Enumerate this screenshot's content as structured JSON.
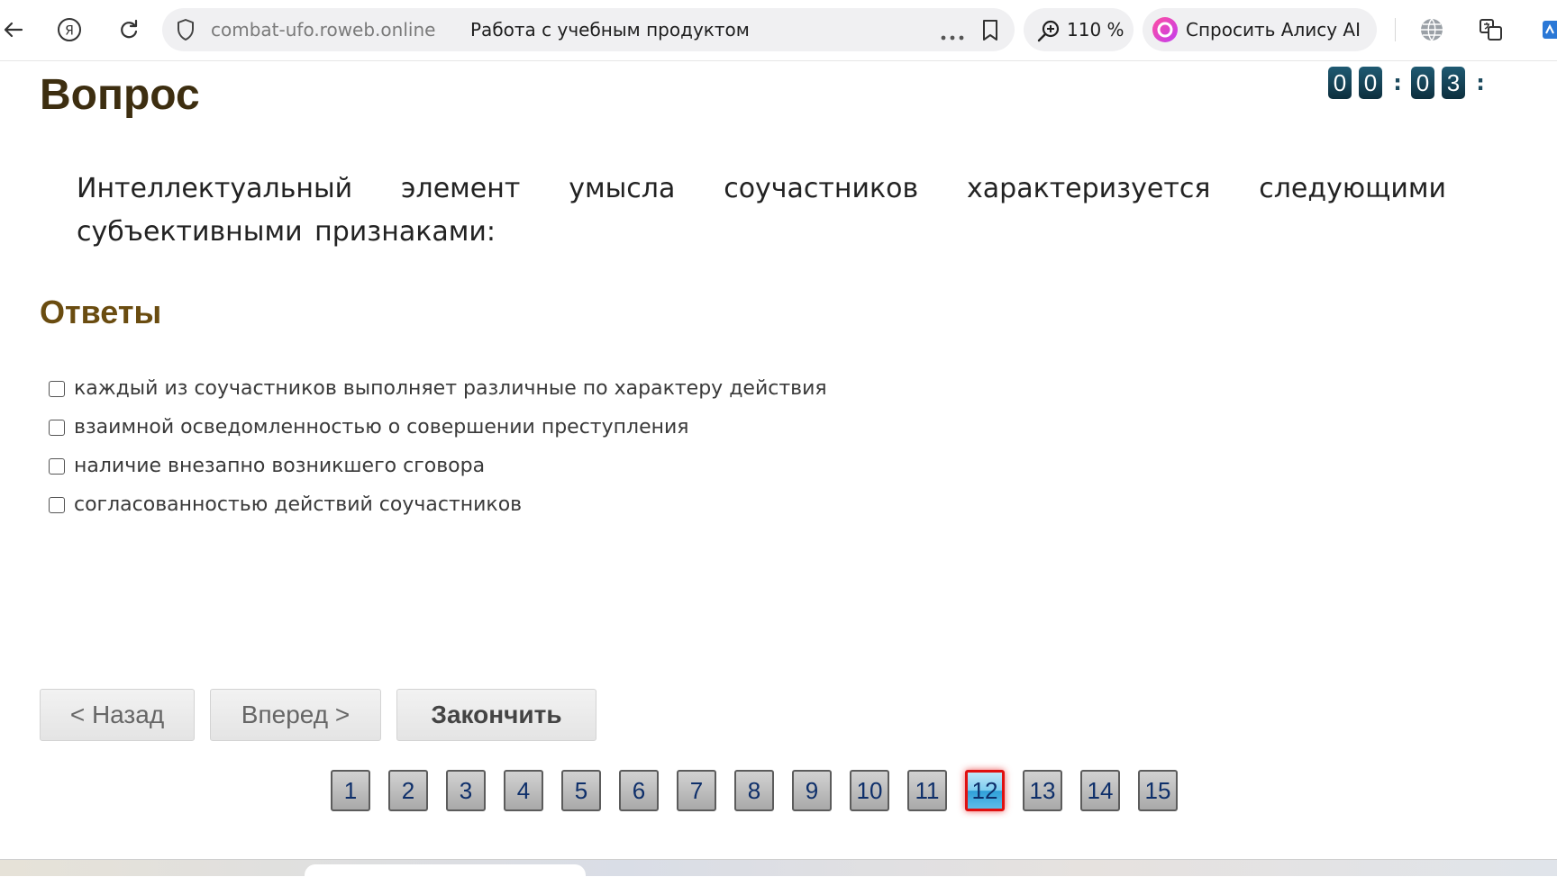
{
  "browser": {
    "host": "combat-ufo.roweb.online",
    "page_title": "Работа с учебным продуктом",
    "zoom": "110 %",
    "alice_label": "Спросить Алису AI",
    "icons": [
      "back-arrow-icon",
      "yandex-icon",
      "reload-icon",
      "shield-icon",
      "more-icon",
      "bookmark-icon",
      "zoom-icon",
      "alice-icon",
      "globe-icon",
      "translate-icon",
      "extension-icon"
    ]
  },
  "page": {
    "title": "Вопрос",
    "timer": {
      "d1": "0",
      "d2": "0",
      "sep": ":",
      "d3": "0",
      "d4": "3"
    },
    "question": "Интеллектуальный элемент умысла соучастников характеризуется следующими субъективными признаками:",
    "answers_title": "Ответы",
    "answers": [
      "каждый из соучастников выполняет различные по характеру действия",
      "взаимной осведомленностью о совершении преступления",
      "наличие внезапно возникшего сговора",
      "согласованностью действий соучастников"
    ],
    "buttons": {
      "back": "< Назад",
      "next": "Вперед >",
      "finish": "Закончить"
    },
    "pages": [
      "1",
      "2",
      "3",
      "4",
      "5",
      "6",
      "7",
      "8",
      "9",
      "10",
      "11",
      "12",
      "13",
      "14",
      "15"
    ],
    "current_page": "12"
  },
  "colors": {
    "title": "#3d2e10",
    "answers_title": "#6a4c10",
    "timer_bg": "#0d2f3e",
    "active_border": "#e01010"
  }
}
